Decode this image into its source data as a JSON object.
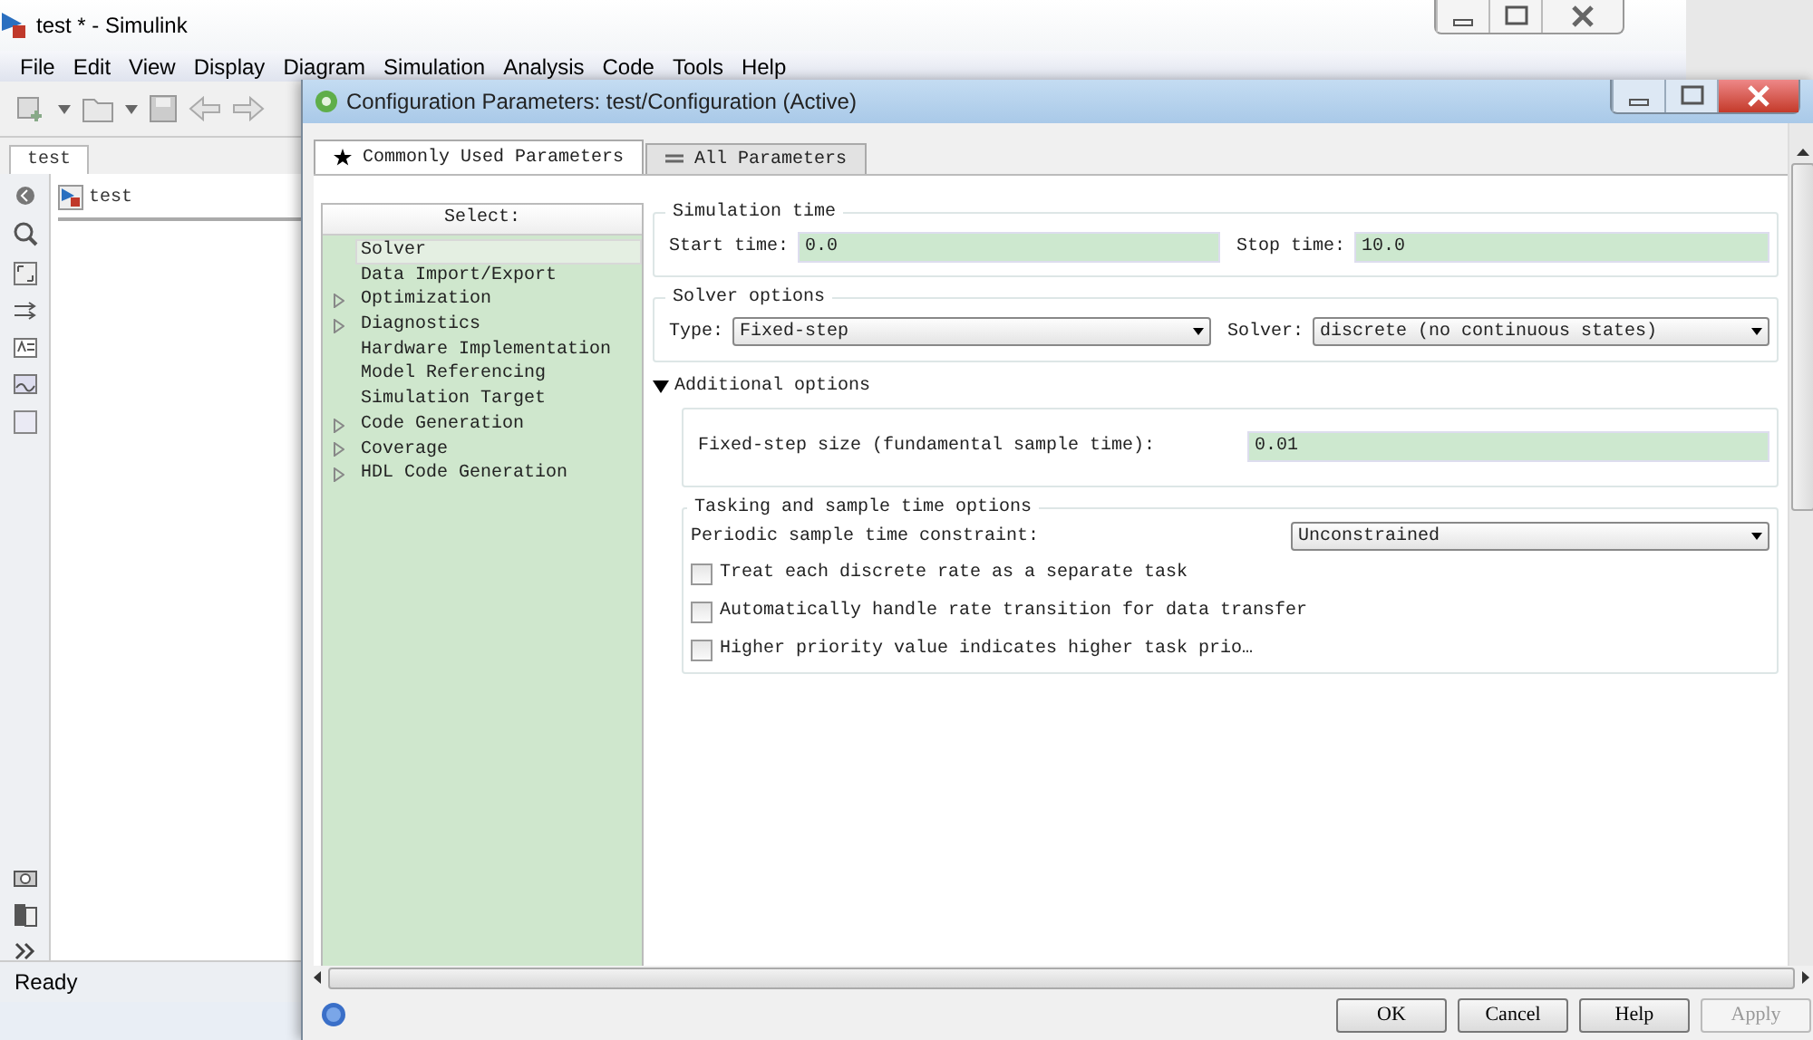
{
  "simulink": {
    "title": "test * - Simulink",
    "menu": [
      {
        "label": "File"
      },
      {
        "label": "Edit"
      },
      {
        "label": "View"
      },
      {
        "label": "Display"
      },
      {
        "label": "Diagram"
      },
      {
        "label": "Simulation"
      },
      {
        "label": "Analysis"
      },
      {
        "label": "Code"
      },
      {
        "label": "Tools"
      },
      {
        "label": "Help"
      }
    ],
    "tab": "test",
    "breadcrumb": "test",
    "status": "Ready"
  },
  "dialog": {
    "title": "Configuration Parameters: test/Configuration (Active)",
    "tabs": [
      {
        "label": "Commonly Used Parameters",
        "selected": true,
        "kind": "star"
      },
      {
        "label": "All Parameters",
        "selected": false,
        "kind": "list"
      }
    ],
    "tree": {
      "header": "Select:",
      "items": [
        {
          "label": "Solver",
          "expandable": false,
          "selected": true
        },
        {
          "label": "Data Import/Export",
          "expandable": false,
          "selected": false
        },
        {
          "label": "Optimization",
          "expandable": true,
          "selected": false
        },
        {
          "label": "Diagnostics",
          "expandable": true,
          "selected": false
        },
        {
          "label": "Hardware Implementation",
          "expandable": false,
          "selected": false
        },
        {
          "label": "Model Referencing",
          "expandable": false,
          "selected": false
        },
        {
          "label": "Simulation Target",
          "expandable": false,
          "selected": false
        },
        {
          "label": "Code Generation",
          "expandable": true,
          "selected": false
        },
        {
          "label": "Coverage",
          "expandable": true,
          "selected": false
        },
        {
          "label": "HDL Code Generation",
          "expandable": true,
          "selected": false
        }
      ]
    },
    "simulation_time": {
      "title": "Simulation time",
      "start_label": "Start time:",
      "start_value": "0.0",
      "stop_label": "Stop time:",
      "stop_value": "10.0"
    },
    "solver_options": {
      "title": "Solver options",
      "type_label": "Type:",
      "type_value": "Fixed-step",
      "solver_label": "Solver:",
      "solver_value": "discrete (no continuous states)"
    },
    "additional_options": {
      "title": "Additional options",
      "expanded": true,
      "fixed_step_label": "Fixed-step size (fundamental sample time):",
      "fixed_step_value": "0.01"
    },
    "tasking": {
      "title": "Tasking and sample time options",
      "constraint_label": "Periodic sample time constraint:",
      "constraint_value": "Unconstrained",
      "checkboxes": [
        {
          "label": "Treat each discrete rate as a separate task",
          "checked": false
        },
        {
          "label": "Automatically handle rate transition for data transfer",
          "checked": false
        },
        {
          "label": "Higher priority value indicates higher task prio…",
          "checked": false
        }
      ]
    },
    "buttons": [
      {
        "label": "OK",
        "disabled": false
      },
      {
        "label": "Cancel",
        "disabled": false
      },
      {
        "label": "Help",
        "disabled": false
      },
      {
        "label": "Apply",
        "disabled": true
      }
    ]
  }
}
